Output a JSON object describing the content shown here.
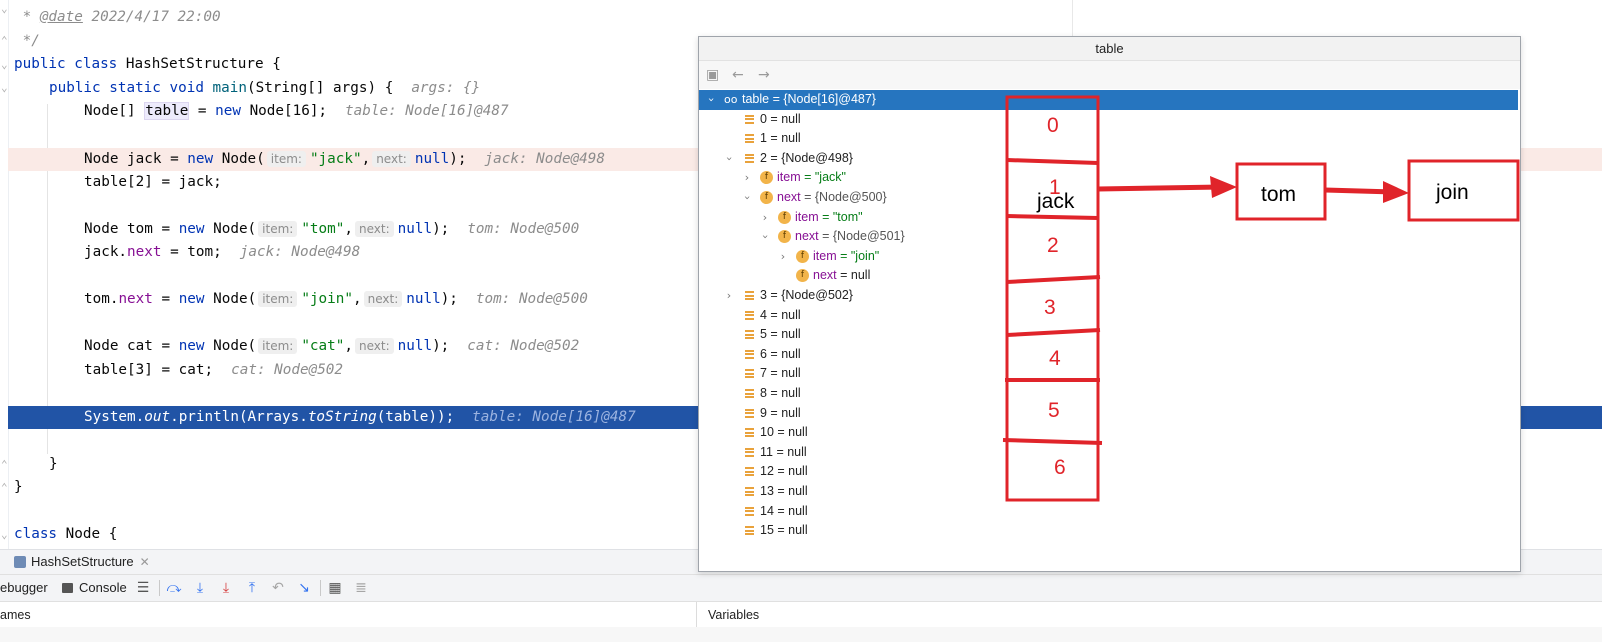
{
  "code": {
    "date_comment_prefix": " * ",
    "date_tag": "@date",
    "date_value": " 2022/4/17 22:00",
    "comment_close": " */",
    "class_decl": {
      "kw": "public class ",
      "name": "HashSetStructure",
      "brace": " {"
    },
    "main_decl": {
      "kw": "public static void ",
      "name": "main",
      "params": "(String[] args) {",
      "hint": "args: {}"
    },
    "line_table": {
      "type": "Node[] ",
      "var": "table",
      "eq": " = ",
      "kw": "new",
      "rest": " Node[16];",
      "hint": "table: Node[16]@487"
    },
    "line_jack": {
      "type": "Node jack = ",
      "kw": "new",
      "ctor": " Node(",
      "p1": "item:",
      "v1": "\"jack\"",
      "comma": ",",
      "p2": "next:",
      "v2": "null",
      "end": ");",
      "hint": "jack: Node@498"
    },
    "line_table2": "table[2] = jack;",
    "line_tom": {
      "type": "Node tom = ",
      "kw": "new",
      "ctor": " Node(",
      "p1": "item:",
      "v1": "\"tom\"",
      "comma": ",",
      "p2": "next:",
      "v2": "null",
      "end": ");",
      "hint": "tom: Node@500"
    },
    "line_jacknext": {
      "a": "jack.",
      "field": "next",
      "b": " = tom;",
      "hint": "jack: Node@498"
    },
    "line_tomnext": {
      "a": "tom.",
      "field": "next",
      "b": " = ",
      "kw": "new",
      "ctor": " Node(",
      "p1": "item:",
      "v1": "\"join\"",
      "comma": ",",
      "p2": "next:",
      "v2": "null",
      "end": ");",
      "hint": "tom: Node@500"
    },
    "line_cat": {
      "type": "Node cat = ",
      "kw": "new",
      "ctor": " Node(",
      "p1": "item:",
      "v1": "\"cat\"",
      "comma": ",",
      "p2": "next:",
      "v2": "null",
      "end": ");",
      "hint": "cat: Node@502"
    },
    "line_table3": {
      "text": "table[3] = cat;",
      "hint": "cat: Node@502"
    },
    "line_println": {
      "a": "System.",
      "out": "out",
      "b": ".println(Arrays.",
      "ts": "toString",
      "c": "(table));",
      "hint": "table: Node[16]@487"
    },
    "close_brace_1": "}",
    "close_brace_2": "}",
    "class_node": {
      "kw": "class ",
      "name": "Node",
      "brace": " {"
    }
  },
  "popup": {
    "title": "table",
    "rows": [
      {
        "text": "table = {Node[16]@487}"
      },
      {
        "text": "0 = null"
      },
      {
        "text": "1 = null"
      },
      {
        "text": "2 = {Node@498}"
      },
      {
        "name": "item",
        "value": " = \"jack\""
      },
      {
        "name": "next",
        "value": " = {Node@500}"
      },
      {
        "name": "item",
        "value": " = \"tom\""
      },
      {
        "name": "next",
        "value": " = {Node@501}"
      },
      {
        "name": "item",
        "value": " = \"join\""
      },
      {
        "name": "next",
        "value": " = null"
      },
      {
        "text": "3 = {Node@502}"
      },
      {
        "text": "4 = null"
      },
      {
        "text": "5 = null"
      },
      {
        "text": "6 = null"
      },
      {
        "text": "7 = null"
      },
      {
        "text": "8 = null"
      },
      {
        "text": "9 = null"
      },
      {
        "text": "10 = null"
      },
      {
        "text": "11 = null"
      },
      {
        "text": "12 = null"
      },
      {
        "text": "13 = null"
      },
      {
        "text": "14 = null"
      },
      {
        "text": "15 = null"
      }
    ]
  },
  "annotation": {
    "indices": [
      "0",
      "1",
      "2",
      "3",
      "4",
      "5",
      "6"
    ],
    "nodes": [
      "jack",
      "tom",
      "join"
    ]
  },
  "bottom": {
    "file_tab": "HashSetStructure",
    "debugger_tab": "ebugger",
    "console_tab": "Console",
    "frames_label": "ames",
    "variables_label": "Variables"
  }
}
